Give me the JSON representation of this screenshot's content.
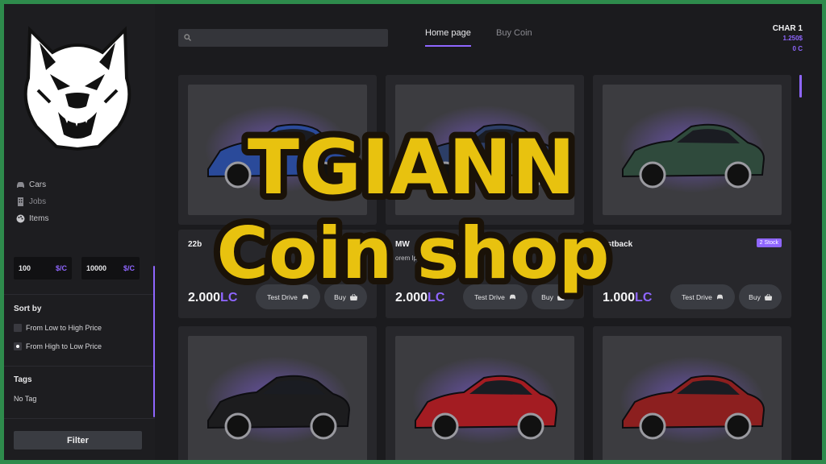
{
  "sidebar": {
    "nav": [
      {
        "label": "Cars",
        "icon": "car-icon"
      },
      {
        "label": "Jobs",
        "icon": "building-icon"
      },
      {
        "label": "Items",
        "icon": "palette-icon"
      }
    ],
    "price_min": {
      "value": "100",
      "unit": "$/C"
    },
    "price_max": {
      "value": "10000",
      "unit": "$/C"
    },
    "sort_title": "Sort by",
    "sort_options": [
      {
        "label": "From Low to High Price",
        "checked": false
      },
      {
        "label": "From High to Low Price",
        "checked": true
      }
    ],
    "tags_title": "Tags",
    "tags_value": "No Tag",
    "filter_label": "Filter"
  },
  "header": {
    "search_placeholder": "",
    "tabs": [
      {
        "label": "Home page",
        "active": true
      },
      {
        "label": "Buy Coin",
        "active": false
      }
    ],
    "user": {
      "name": "CHAR 1",
      "money": "1.250$",
      "coin": "0 C"
    }
  },
  "products": [
    {
      "title": "22b",
      "desc": "",
      "stock": "",
      "price": "2.000",
      "currency": "LC",
      "test_drive": "Test Drive",
      "buy": "Buy",
      "car_color": "#2a4a9a"
    },
    {
      "title": "MW",
      "desc": "orem Ip... pesett... dustr...",
      "stock": "",
      "price": "2.000",
      "currency": "LC",
      "test_drive": "Test Drive",
      "buy": "Buy",
      "car_color": "#2c3e66"
    },
    {
      "title": "astback",
      "desc": "",
      "stock": "2 Stock",
      "price": "1.000",
      "currency": "LC",
      "test_drive": "Test Drive",
      "buy": "Buy",
      "car_color": "#2f4a3c"
    },
    {
      "title": "",
      "car_color": "#1c1c1e"
    },
    {
      "title": "",
      "car_color": "#a31c22"
    },
    {
      "title": "",
      "car_color": "#8c1f1f"
    }
  ],
  "overlay": {
    "line1": "TGIANN",
    "line2": "Coin shop"
  },
  "colors": {
    "accent": "#8f66ff",
    "background": "#1b1b1e",
    "frame": "#2e8b4c",
    "overlay_text": "#e8c20f"
  }
}
